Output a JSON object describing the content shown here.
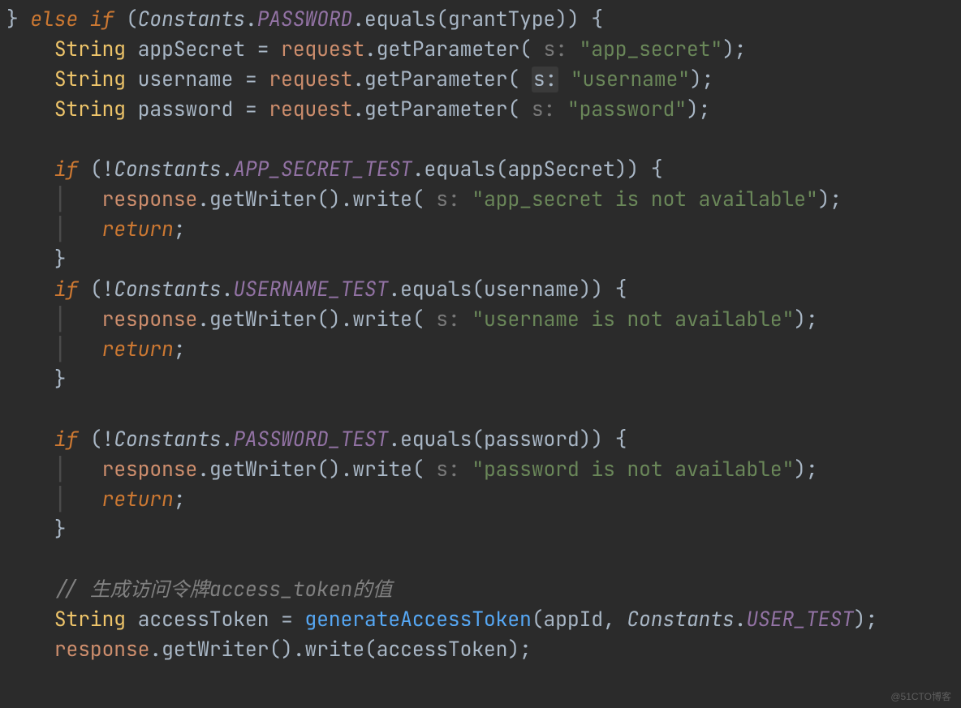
{
  "code": {
    "lines": [
      [
        {
          "cls": "pun",
          "t": "} "
        },
        {
          "cls": "kw",
          "t": "else if"
        },
        {
          "cls": "pun",
          "t": " ("
        },
        {
          "cls": "var cls",
          "t": "Constants"
        },
        {
          "cls": "pun",
          "t": "."
        },
        {
          "cls": "mem cls",
          "t": "PASSWORD"
        },
        {
          "cls": "pun",
          "t": "."
        },
        {
          "cls": "var",
          "t": "equals"
        },
        {
          "cls": "pun",
          "t": "("
        },
        {
          "cls": "var",
          "t": "grantType"
        },
        {
          "cls": "pun",
          "t": ")) {"
        }
      ],
      [
        {
          "cls": "pun",
          "t": "    "
        },
        {
          "cls": "type",
          "t": "String"
        },
        {
          "cls": "pun",
          "t": " "
        },
        {
          "cls": "var",
          "t": "appSecret"
        },
        {
          "cls": "pun",
          "t": " = "
        },
        {
          "cls": "fld",
          "t": "request"
        },
        {
          "cls": "pun",
          "t": "."
        },
        {
          "cls": "var",
          "t": "getParameter"
        },
        {
          "cls": "pun",
          "t": "("
        },
        {
          "cls": "hint",
          "t": " s: "
        },
        {
          "cls": "str",
          "t": "\"app_secret\""
        },
        {
          "cls": "pun",
          "t": ");"
        }
      ],
      [
        {
          "cls": "pun",
          "t": "    "
        },
        {
          "cls": "type",
          "t": "String"
        },
        {
          "cls": "pun",
          "t": " "
        },
        {
          "cls": "var",
          "t": "username"
        },
        {
          "cls": "pun",
          "t": " = "
        },
        {
          "cls": "fld",
          "t": "request"
        },
        {
          "cls": "pun",
          "t": "."
        },
        {
          "cls": "var",
          "t": "getParameter"
        },
        {
          "cls": "pun",
          "t": "("
        },
        {
          "cls": "hint",
          "t": " "
        },
        {
          "cls": "hintbox",
          "t": "s:"
        },
        {
          "cls": "hint",
          "t": " "
        },
        {
          "cls": "str",
          "t": "\"username\""
        },
        {
          "cls": "pun",
          "t": ");"
        }
      ],
      [
        {
          "cls": "pun",
          "t": "    "
        },
        {
          "cls": "type",
          "t": "String"
        },
        {
          "cls": "pun",
          "t": " "
        },
        {
          "cls": "var",
          "t": "password"
        },
        {
          "cls": "pun",
          "t": " = "
        },
        {
          "cls": "fld",
          "t": "request"
        },
        {
          "cls": "pun",
          "t": "."
        },
        {
          "cls": "var",
          "t": "getParameter"
        },
        {
          "cls": "pun",
          "t": "("
        },
        {
          "cls": "hint",
          "t": " s: "
        },
        {
          "cls": "str",
          "t": "\"password\""
        },
        {
          "cls": "pun",
          "t": ");"
        }
      ],
      [
        {
          "cls": "pun",
          "t": " "
        }
      ],
      [
        {
          "cls": "pun",
          "t": "    "
        },
        {
          "cls": "kw",
          "t": "if"
        },
        {
          "cls": "pun",
          "t": " (!"
        },
        {
          "cls": "var cls",
          "t": "Constants"
        },
        {
          "cls": "pun",
          "t": "."
        },
        {
          "cls": "mem cls",
          "t": "APP_SECRET_TEST"
        },
        {
          "cls": "pun",
          "t": "."
        },
        {
          "cls": "var",
          "t": "equals"
        },
        {
          "cls": "pun",
          "t": "("
        },
        {
          "cls": "var",
          "t": "appSecret"
        },
        {
          "cls": "pun",
          "t": ")) {"
        }
      ],
      [
        {
          "cls": "pun",
          "t": "    "
        },
        {
          "cls": "guide",
          "t": "│"
        },
        {
          "cls": "pun",
          "t": "   "
        },
        {
          "cls": "fld",
          "t": "response"
        },
        {
          "cls": "pun",
          "t": "."
        },
        {
          "cls": "var",
          "t": "getWriter"
        },
        {
          "cls": "pun",
          "t": "()."
        },
        {
          "cls": "var",
          "t": "write"
        },
        {
          "cls": "pun",
          "t": "("
        },
        {
          "cls": "hint",
          "t": " s: "
        },
        {
          "cls": "str",
          "t": "\"app_secret is not available\""
        },
        {
          "cls": "pun",
          "t": ");"
        }
      ],
      [
        {
          "cls": "pun",
          "t": "    "
        },
        {
          "cls": "guide",
          "t": "│"
        },
        {
          "cls": "pun",
          "t": "   "
        },
        {
          "cls": "kw",
          "t": "return"
        },
        {
          "cls": "pun",
          "t": ";"
        }
      ],
      [
        {
          "cls": "pun",
          "t": "    }"
        }
      ],
      [
        {
          "cls": "pun",
          "t": "    "
        },
        {
          "cls": "kw",
          "t": "if"
        },
        {
          "cls": "pun",
          "t": " (!"
        },
        {
          "cls": "var cls",
          "t": "Constants"
        },
        {
          "cls": "pun",
          "t": "."
        },
        {
          "cls": "mem cls",
          "t": "USERNAME_TEST"
        },
        {
          "cls": "pun",
          "t": "."
        },
        {
          "cls": "var",
          "t": "equals"
        },
        {
          "cls": "pun",
          "t": "("
        },
        {
          "cls": "var",
          "t": "username"
        },
        {
          "cls": "pun",
          "t": ")) {"
        }
      ],
      [
        {
          "cls": "pun",
          "t": "    "
        },
        {
          "cls": "guide",
          "t": "│"
        },
        {
          "cls": "pun",
          "t": "   "
        },
        {
          "cls": "fld",
          "t": "response"
        },
        {
          "cls": "pun",
          "t": "."
        },
        {
          "cls": "var",
          "t": "getWriter"
        },
        {
          "cls": "pun",
          "t": "()."
        },
        {
          "cls": "var",
          "t": "write"
        },
        {
          "cls": "pun",
          "t": "("
        },
        {
          "cls": "hint",
          "t": " s: "
        },
        {
          "cls": "str",
          "t": "\"username is not available\""
        },
        {
          "cls": "pun",
          "t": ");"
        }
      ],
      [
        {
          "cls": "pun",
          "t": "    "
        },
        {
          "cls": "guide",
          "t": "│"
        },
        {
          "cls": "pun",
          "t": "   "
        },
        {
          "cls": "kw",
          "t": "return"
        },
        {
          "cls": "pun",
          "t": ";"
        }
      ],
      [
        {
          "cls": "pun",
          "t": "    }"
        }
      ],
      [
        {
          "cls": "pun",
          "t": " "
        }
      ],
      [
        {
          "cls": "pun",
          "t": "    "
        },
        {
          "cls": "kw",
          "t": "if"
        },
        {
          "cls": "pun",
          "t": " (!"
        },
        {
          "cls": "var cls",
          "t": "Constants"
        },
        {
          "cls": "pun",
          "t": "."
        },
        {
          "cls": "mem cls",
          "t": "PASSWORD_TEST"
        },
        {
          "cls": "pun",
          "t": "."
        },
        {
          "cls": "var",
          "t": "equals"
        },
        {
          "cls": "pun",
          "t": "("
        },
        {
          "cls": "var",
          "t": "password"
        },
        {
          "cls": "pun",
          "t": ")) {"
        }
      ],
      [
        {
          "cls": "pun",
          "t": "    "
        },
        {
          "cls": "guide",
          "t": "│"
        },
        {
          "cls": "pun",
          "t": "   "
        },
        {
          "cls": "fld",
          "t": "response"
        },
        {
          "cls": "pun",
          "t": "."
        },
        {
          "cls": "var",
          "t": "getWriter"
        },
        {
          "cls": "pun",
          "t": "()."
        },
        {
          "cls": "var",
          "t": "write"
        },
        {
          "cls": "pun",
          "t": "("
        },
        {
          "cls": "hint",
          "t": " s: "
        },
        {
          "cls": "str",
          "t": "\"password is not available\""
        },
        {
          "cls": "pun",
          "t": ");"
        }
      ],
      [
        {
          "cls": "pun",
          "t": "    "
        },
        {
          "cls": "guide",
          "t": "│"
        },
        {
          "cls": "pun",
          "t": "   "
        },
        {
          "cls": "kw",
          "t": "return"
        },
        {
          "cls": "pun",
          "t": ";"
        }
      ],
      [
        {
          "cls": "pun",
          "t": "    }"
        }
      ],
      [
        {
          "cls": "pun",
          "t": " "
        }
      ],
      [
        {
          "cls": "pun",
          "t": "    "
        },
        {
          "cls": "cmt",
          "t": "// 生成访问令牌access_token的值"
        }
      ],
      [
        {
          "cls": "pun",
          "t": "    "
        },
        {
          "cls": "type",
          "t": "String"
        },
        {
          "cls": "pun",
          "t": " "
        },
        {
          "cls": "var",
          "t": "accessToken"
        },
        {
          "cls": "pun",
          "t": " = "
        },
        {
          "cls": "mth",
          "t": "generateAccessToken"
        },
        {
          "cls": "pun",
          "t": "("
        },
        {
          "cls": "var",
          "t": "appId"
        },
        {
          "cls": "pun",
          "t": ", "
        },
        {
          "cls": "var cls",
          "t": "Constants"
        },
        {
          "cls": "pun",
          "t": "."
        },
        {
          "cls": "mem cls",
          "t": "USER_TEST"
        },
        {
          "cls": "pun",
          "t": ");"
        }
      ],
      [
        {
          "cls": "pun",
          "t": "    "
        },
        {
          "cls": "fld",
          "t": "response"
        },
        {
          "cls": "pun",
          "t": "."
        },
        {
          "cls": "var",
          "t": "getWriter"
        },
        {
          "cls": "pun",
          "t": "()."
        },
        {
          "cls": "var",
          "t": "write"
        },
        {
          "cls": "pun",
          "t": "("
        },
        {
          "cls": "var",
          "t": "accessToken"
        },
        {
          "cls": "pun",
          "t": ");"
        }
      ]
    ]
  },
  "watermark": "@51CTO博客"
}
